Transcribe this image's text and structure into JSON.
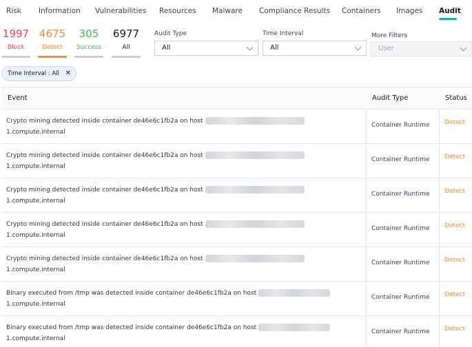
{
  "tabs": [
    "Risk",
    "Information",
    "Vulnerabilities",
    "Resources",
    "Malware",
    "Compliance Results",
    "Containers",
    "Images",
    "Audit"
  ],
  "active_tab": "Audit",
  "counters": {
    "block": {
      "value": "1997",
      "label": "Block"
    },
    "detect": {
      "value": "4675",
      "label": "Detect"
    },
    "success": {
      "value": "305",
      "label": "Success"
    },
    "all": {
      "value": "6977",
      "label": "All"
    }
  },
  "filters": {
    "audit_type": {
      "label": "Audit Type",
      "value": "All"
    },
    "time_interval": {
      "label": "Time Interval",
      "value": "All"
    },
    "more_filters": {
      "label": "More Filters",
      "placeholder": "User"
    }
  },
  "chip": {
    "text": "Time Interval : All"
  },
  "table": {
    "headers": {
      "event": "Event",
      "audit_type": "Audit Type",
      "status": "Status"
    },
    "rows": [
      {
        "event": "Crypto mining detected inside container de46e6c1fb2a on host",
        "host_suffix": "1.compute.internal",
        "audit_type": "Container Runtime",
        "status": "Detect"
      },
      {
        "event": "Crypto mining detected inside container de46e6c1fb2a on host",
        "host_suffix": "1.compute.internal",
        "audit_type": "Container Runtime",
        "status": "Detect"
      },
      {
        "event": "Crypto mining detected inside container de46e6c1fb2a on host",
        "host_suffix": "1.compute.internal",
        "audit_type": "Container Runtime",
        "status": "Detect"
      },
      {
        "event": "Crypto mining detected inside container de46e6c1fb2a on host",
        "host_suffix": "1.compute.internal",
        "audit_type": "Container Runtime",
        "status": "Detect"
      },
      {
        "event": "Crypto mining detected inside container de46e6c1fb2a on host",
        "host_suffix": "1.compute.internal",
        "audit_type": "Container Runtime",
        "status": "Detect"
      },
      {
        "event": "Binary executed from /tmp was detected inside container de46e6c1fb2a on host",
        "host_suffix": "1.compute.internal",
        "audit_type": "Container Runtime",
        "status": "Detect"
      },
      {
        "event": "Binary executed from /tmp was detected inside container de46e6c1fb2a on host",
        "host_suffix": "1.compute.internal",
        "audit_type": "Container Runtime",
        "status": "Detect"
      }
    ]
  },
  "colors": {
    "accent": "#14b8a6",
    "block": "#e5484d",
    "detect": "#f08c3b",
    "success": "#3fb950"
  }
}
